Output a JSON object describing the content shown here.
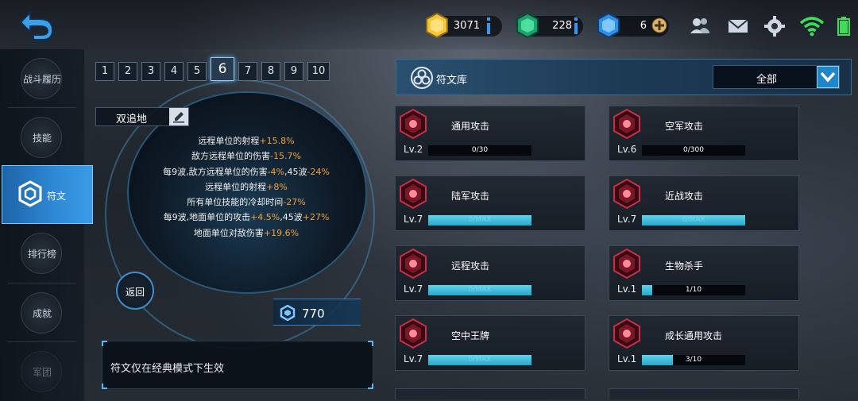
{
  "topbar": {
    "gold": {
      "value": "3071",
      "icon": "gold-coin-icon"
    },
    "emerald": {
      "value": "228",
      "icon": "emerald-gem-icon"
    },
    "crystal": {
      "value": "6",
      "icon": "blue-crystal-icon"
    },
    "icons": [
      "friends-icon",
      "mail-icon",
      "settings-icon",
      "wifi-icon",
      "battery-icon"
    ]
  },
  "sidebar": {
    "items": [
      {
        "label": "战斗履历"
      },
      {
        "label": "技能"
      },
      {
        "label": "符文"
      },
      {
        "label": "排行榜"
      },
      {
        "label": "成就"
      },
      {
        "label": "军团"
      }
    ],
    "active_index": 2
  },
  "preset": {
    "tabs": [
      "1",
      "2",
      "3",
      "4",
      "5",
      "6",
      "7",
      "8",
      "9",
      "10"
    ],
    "active_tab": "6",
    "name": "双追地",
    "stats": [
      {
        "text": "远程单位的射程",
        "value": "+15.8%",
        "tail": ""
      },
      {
        "text": "敌方远程单位的伤害",
        "value": "-15.7%",
        "tail": ""
      },
      {
        "text": "每9波,敌方远程单位的伤害",
        "value": "-4%",
        "mid": ",45波",
        "value2": "-24%"
      },
      {
        "text": "远程单位的射程",
        "value": "+8%",
        "tail": ""
      },
      {
        "text": "所有单位技能的冷却时间",
        "value": "-27%",
        "tail": ""
      },
      {
        "text": "每9波,地面单位的攻击",
        "value": "+4.5%",
        "mid": ",45波",
        "value2": "+27%"
      },
      {
        "text": "地面单位对敌伤害",
        "value": "+19.6%",
        "tail": ""
      }
    ],
    "return_label": "返回",
    "power": "770",
    "notice": "符文仅在经典模式下生效"
  },
  "library": {
    "title": "符文库",
    "filter": "全部",
    "cards": [
      {
        "name": "通用攻击",
        "level": "Lv.2",
        "progress": "0/30",
        "fill": 0,
        "max": false
      },
      {
        "name": "空军攻击",
        "level": "Lv.6",
        "progress": "0/300",
        "fill": 0,
        "max": false
      },
      {
        "name": "陆军攻击",
        "level": "Lv.7",
        "progress": "0/MAX",
        "fill": 1,
        "max": true
      },
      {
        "name": "近战攻击",
        "level": "Lv.7",
        "progress": "0/MAX",
        "fill": 1,
        "max": true
      },
      {
        "name": "远程攻击",
        "level": "Lv.7",
        "progress": "0/MAX",
        "fill": 1,
        "max": true
      },
      {
        "name": "生物杀手",
        "level": "Lv.1",
        "progress": "1/10",
        "fill": 0.1,
        "max": false
      },
      {
        "name": "空中王牌",
        "level": "Lv.7",
        "progress": "0/MAX",
        "fill": 1,
        "max": true
      },
      {
        "name": "成长通用攻击",
        "level": "Lv.1",
        "progress": "3/10",
        "fill": 0.3,
        "max": false
      }
    ]
  },
  "colors": {
    "highlight": "#f3a13a",
    "accent_blue": "#2f8ad6",
    "bar_fill": "#5fd4ea"
  }
}
